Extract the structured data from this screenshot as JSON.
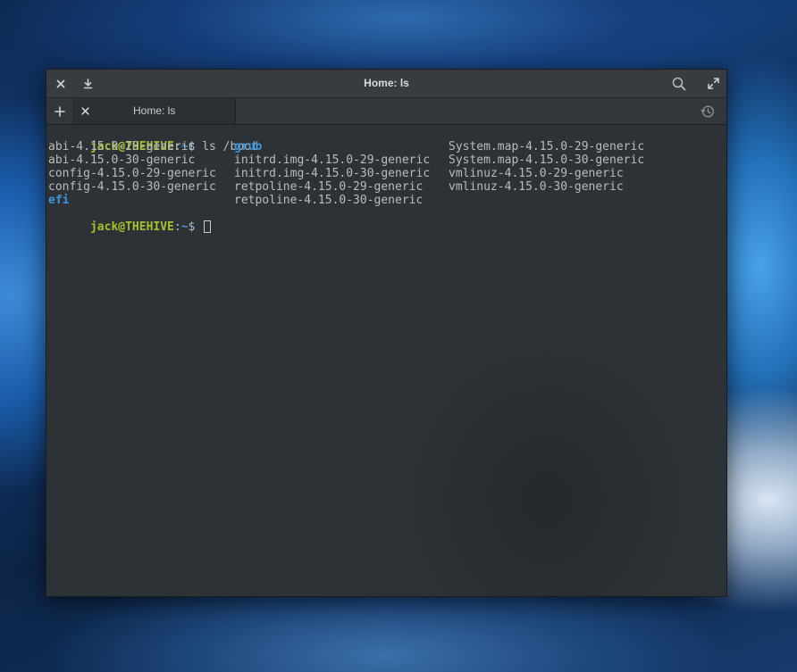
{
  "window": {
    "title": "Home: ls",
    "close_icon": "close-icon",
    "download_icon": "download-icon",
    "search_icon": "search-icon",
    "maximize_icon": "maximize-icon"
  },
  "tabs": {
    "add_icon": "plus-icon",
    "history_icon": "history-icon",
    "items": [
      {
        "label": "Home: ls",
        "close_icon": "close-icon"
      }
    ]
  },
  "terminal": {
    "prompt1": {
      "user": "jack@THEHIVE",
      "sep": ":",
      "path": "~",
      "sym": "$",
      "command": " ls /boot"
    },
    "rows": [
      {
        "c1": "abi-4.15.0-29-generic",
        "c2": "grub",
        "c3": "System.map-4.15.0-29-generic"
      },
      {
        "c1": "abi-4.15.0-30-generic",
        "c2": "initrd.img-4.15.0-29-generic",
        "c3": "System.map-4.15.0-30-generic"
      },
      {
        "c1": "config-4.15.0-29-generic",
        "c2": "initrd.img-4.15.0-30-generic",
        "c3": "vmlinuz-4.15.0-29-generic"
      },
      {
        "c1": "config-4.15.0-30-generic",
        "c2": "retpoline-4.15.0-29-generic",
        "c3": "vmlinuz-4.15.0-30-generic"
      },
      {
        "c1": "efi",
        "c2": "retpoline-4.15.0-30-generic",
        "c3": ""
      }
    ],
    "prompt2": {
      "user": "jack@THEHIVE",
      "sep": ":",
      "path": "~",
      "sym": "$",
      "command": " "
    },
    "colors": {
      "user": "#a5c02e",
      "path": "#3e9bde",
      "dir": "#3a97e0",
      "text": "#b9bcbe",
      "background": "#2d3236"
    }
  }
}
